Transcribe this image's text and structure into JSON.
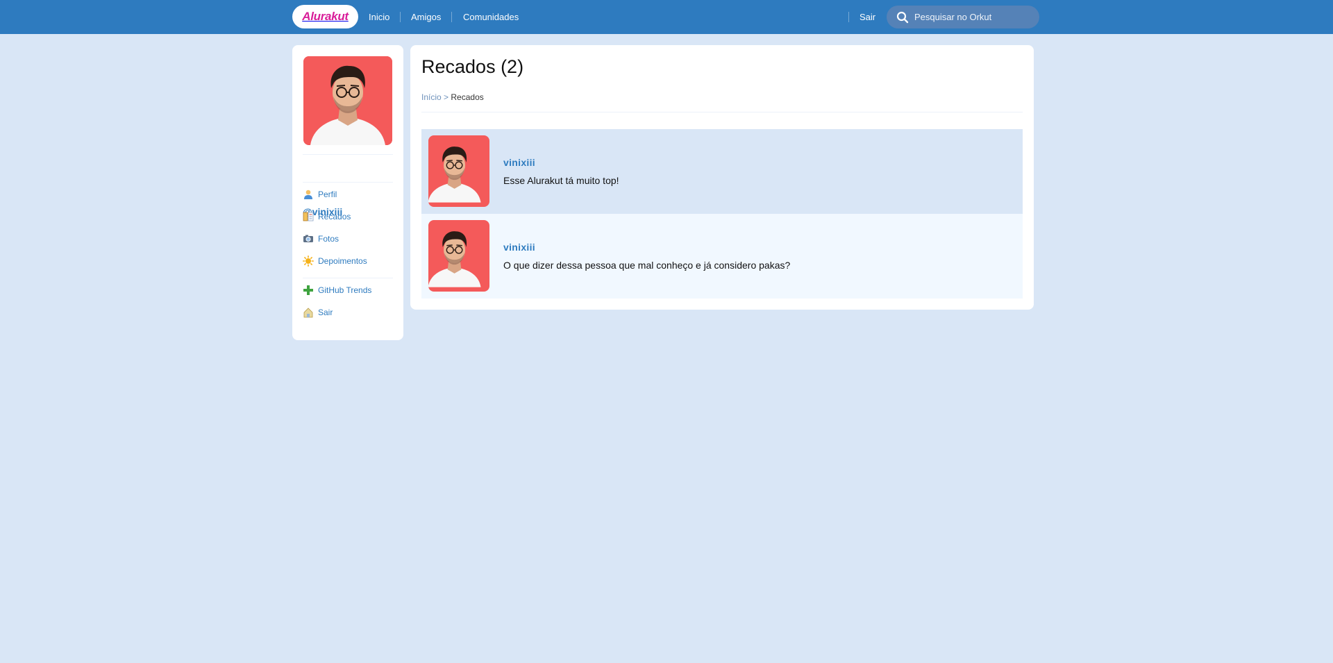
{
  "header": {
    "logo_text": "Alurakut",
    "nav": [
      {
        "label": "Inicio"
      },
      {
        "label": "Amigos"
      },
      {
        "label": "Comunidades"
      }
    ],
    "logout_label": "Sair",
    "search_placeholder": "Pesquisar no Orkut",
    "bar_color": "#2e7bbf"
  },
  "sidebar": {
    "username": "@vinixiii",
    "menu": [
      {
        "label": "Perfil",
        "icon": "user-icon"
      },
      {
        "label": "Recados",
        "icon": "book-icon"
      },
      {
        "label": "Fotos",
        "icon": "camera-icon"
      },
      {
        "label": "Depoimentos",
        "icon": "sun-icon"
      }
    ],
    "menu_secondary": [
      {
        "label": "GitHub Trends",
        "icon": "plus-icon"
      },
      {
        "label": "Sair",
        "icon": "exit-icon"
      }
    ]
  },
  "main": {
    "title": "Recados (2)",
    "breadcrumb": {
      "home": "Início",
      "separator": ">",
      "current": "Recados"
    },
    "scraps": [
      {
        "author": "vinixiii",
        "message": "Esse Alurakut tá muito top!"
      },
      {
        "author": "vinixiii",
        "message": "O que dizer dessa pessoa que mal conheço e já considero pakas?"
      }
    ]
  },
  "colors": {
    "page_background": "#d9e6f6",
    "accent": "#2e7bbf",
    "logo_pink": "#d81d99",
    "avatar_background": "#f45a5a"
  }
}
